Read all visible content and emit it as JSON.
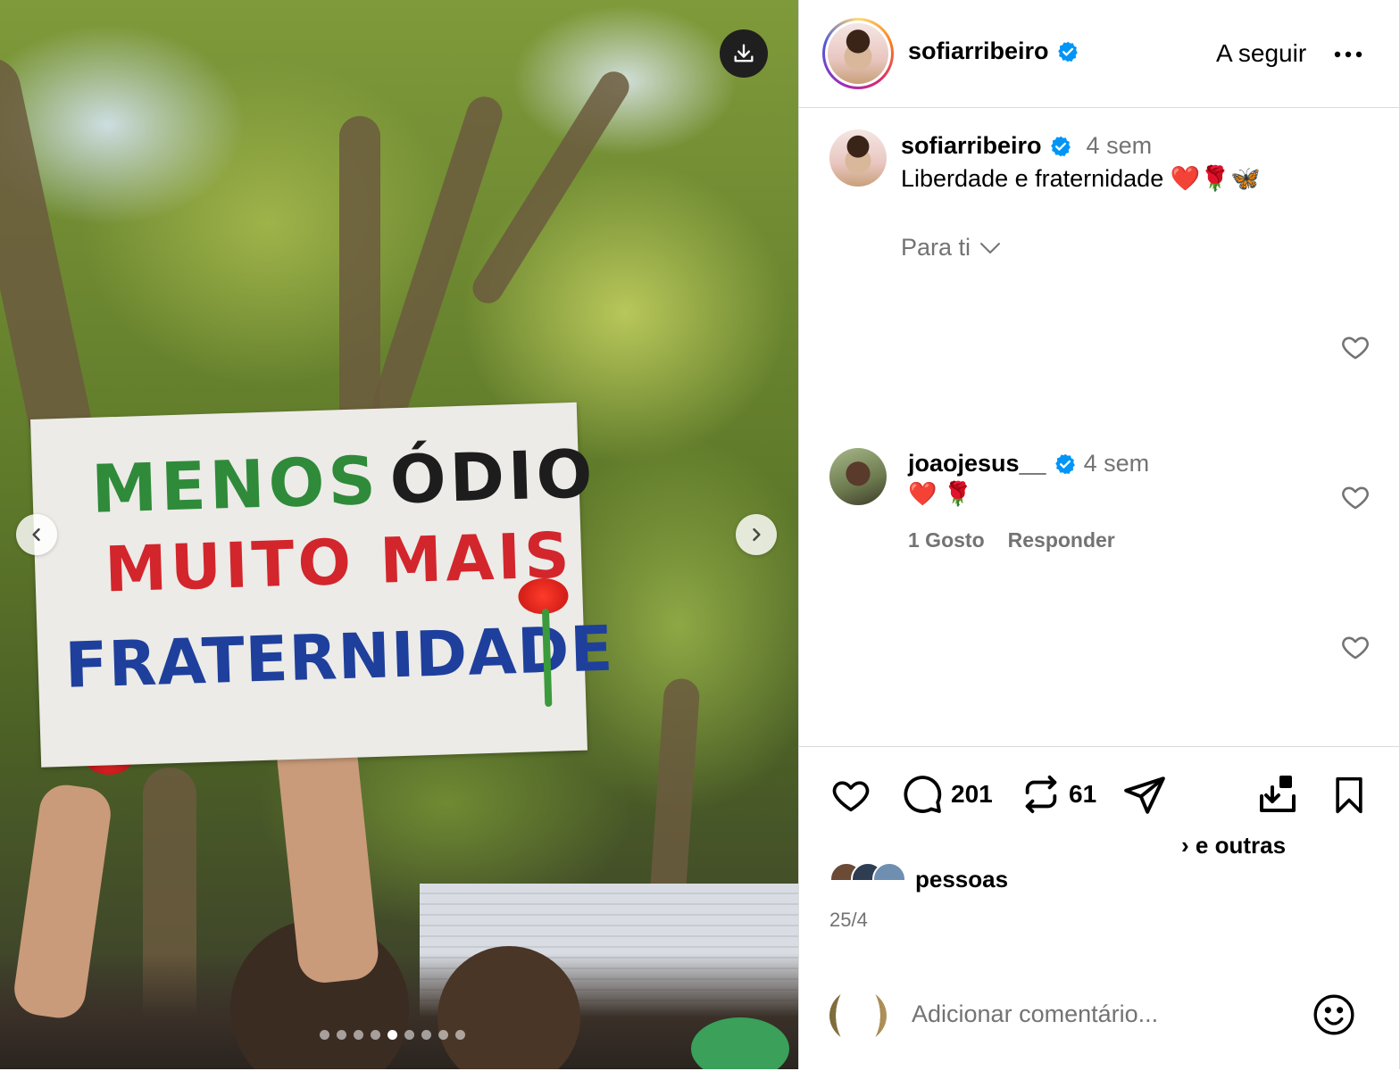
{
  "photo": {
    "sign_lines": [
      "MENOS",
      "ÓDIO",
      "MUITO MAIS",
      "FRATERNIDADE"
    ],
    "download_icon": "download-icon",
    "prev_icon": "chevron-left-icon",
    "next_icon": "chevron-right-icon",
    "carousel": {
      "count": 9,
      "active_index": 4
    }
  },
  "header": {
    "username": "sofiarribeiro",
    "follow_label": "A seguir",
    "more_icon": "more-horizontal-icon"
  },
  "caption": {
    "username": "sofiarribeiro",
    "time": "4 sem",
    "text": "Liberdade e fraternidade ❤️🌹🦋",
    "for_you_label": "Para ti"
  },
  "comments": [
    {
      "username": "joaojesus__",
      "time": "4 sem",
      "text": "❤️ 🌹",
      "likes_label": "1 Gosto",
      "reply_label": "Responder"
    }
  ],
  "actions": {
    "comments_count": "201",
    "reposts_count": "61"
  },
  "likes": {
    "text_right": "› e outras",
    "text_line2": "pessoas"
  },
  "date": "25/4",
  "add_comment": {
    "placeholder": "Adicionar comentário..."
  },
  "colors": {
    "verified": "#0095f6",
    "muted": "#737373",
    "border": "#dbdbdb"
  }
}
